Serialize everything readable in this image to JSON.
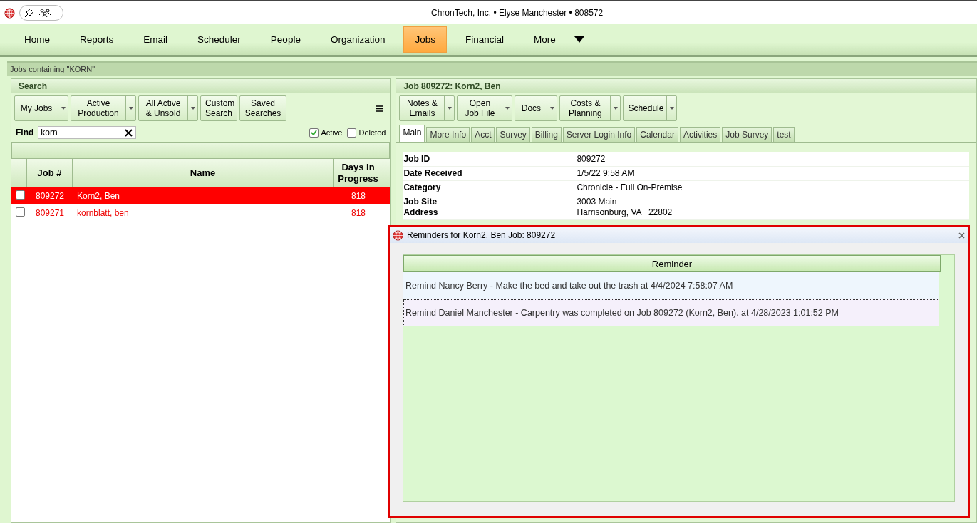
{
  "header": {
    "separator": "•",
    "parts": [
      "ChronTech, Inc.",
      "Elyse Manchester",
      "808572"
    ]
  },
  "nav": [
    {
      "label": "Home",
      "selected": false
    },
    {
      "label": "Reports",
      "selected": false
    },
    {
      "label": "Email",
      "selected": false
    },
    {
      "label": "Scheduler",
      "selected": false
    },
    {
      "label": "People",
      "selected": false
    },
    {
      "label": "Organization",
      "selected": false
    },
    {
      "label": "Jobs",
      "selected": true
    },
    {
      "label": "Financial",
      "selected": false
    },
    {
      "label": "More",
      "selected": false
    }
  ],
  "breadcrumb": "Jobs containing \"KORN\"",
  "search": {
    "title": "Search",
    "buttons": [
      {
        "label": "My Jobs",
        "dropdown": true
      },
      {
        "label": "Active Production",
        "dropdown": true
      },
      {
        "label": "All Active & Unsold",
        "dropdown": true
      },
      {
        "label": "Custom Search",
        "dropdown": false
      },
      {
        "label": "Saved Searches",
        "dropdown": false
      }
    ],
    "find_label": "Find",
    "find_value": "korn",
    "filters": [
      {
        "label": "Active",
        "checked": true
      },
      {
        "label": "Deleted",
        "checked": false
      }
    ],
    "columns": [
      "Job #",
      "Name",
      "Days in Progress"
    ],
    "rows": [
      {
        "job": "809272",
        "name": "Korn2, Ben",
        "days": "818",
        "selected": true,
        "checked": false
      },
      {
        "job": "809271",
        "name": "kornblatt, ben",
        "days": "818",
        "selected": false,
        "checked": false
      }
    ]
  },
  "job": {
    "title": "Job 809272: Korn2, Ben",
    "buttons": [
      {
        "label": "Notes & Emails"
      },
      {
        "label": "Open Job File"
      },
      {
        "label": "Docs"
      },
      {
        "label": "Costs & Planning"
      },
      {
        "label": "Schedule"
      }
    ],
    "tabs": [
      {
        "label": "Main",
        "selected": true
      },
      {
        "label": "More Info",
        "selected": false
      },
      {
        "label": "Acct",
        "selected": false
      },
      {
        "label": "Survey",
        "selected": false
      },
      {
        "label": "Billing",
        "selected": false
      },
      {
        "label": "Server Login Info",
        "selected": false
      },
      {
        "label": "Calendar",
        "selected": false
      },
      {
        "label": "Activities",
        "selected": false
      },
      {
        "label": "Job Survey",
        "selected": false
      },
      {
        "label": "test",
        "selected": false
      }
    ],
    "fields": [
      {
        "label": [
          "Job ID"
        ],
        "value": [
          "809272"
        ]
      },
      {
        "label": [
          "Date Received"
        ],
        "value": [
          "1/5/22 9:58 AM"
        ]
      },
      {
        "label": [
          "Category"
        ],
        "value": [
          "Chronicle - Full On-Premise"
        ]
      },
      {
        "label": [
          "Job Site",
          "Address"
        ],
        "value": [
          "3003 Main",
          "Harrisonburg, VA   22802"
        ]
      }
    ]
  },
  "dialog": {
    "title": "Reminders for Korn2, Ben Job: 809272",
    "column": "Reminder",
    "rows": [
      {
        "text": "Remind Nancy Berry - Make the bed and take out the trash at 4/4/2024 7:58:07 AM",
        "selected": false
      },
      {
        "text": "Remind Daniel Manchester - Carpentry was completed on Job 809272 (Korn2, Ben). at 4/28/2023 1:01:52 PM",
        "selected": true
      }
    ]
  }
}
